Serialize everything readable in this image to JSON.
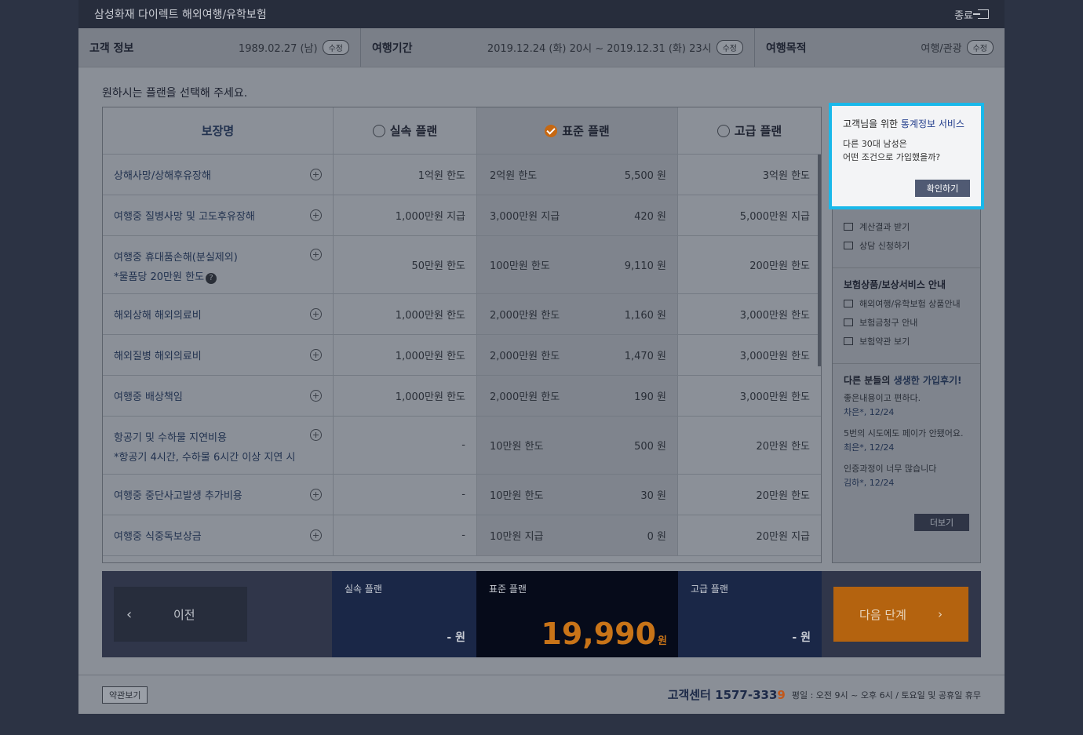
{
  "titlebar": {
    "title": "삼성화재 다이렉트 해외여행/유학보험",
    "exit_label": "종료"
  },
  "info": {
    "customer": {
      "label": "고객 정보",
      "value": "1989.02.27 (남)",
      "edit": "수정"
    },
    "period": {
      "label": "여행기간",
      "value": "2019.12.24 (화) 20시 ~ 2019.12.31 (화) 23시",
      "edit": "수정"
    },
    "purpose": {
      "label": "여행목적",
      "value": "여행/관광",
      "edit": "수정"
    }
  },
  "prompt": "원하시는 플랜을 선택해 주세요.",
  "table": {
    "headers": {
      "name": "보장명",
      "basic": "실속 플랜",
      "standard": "표준 플랜",
      "premium": "고급 플랜"
    },
    "rows": [
      {
        "name": "상해사망/상해후유장해",
        "basic": "1억원 한도",
        "std": "2억원 한도",
        "std_price": "5,500 원",
        "prem": "3억원 한도"
      },
      {
        "name": "여행중 질병사망 및 고도후유장해",
        "basic": "1,000만원 지급",
        "std": "3,000만원 지급",
        "std_price": "420 원",
        "prem": "5,000만원 지급"
      },
      {
        "name": "여행중 휴대품손해(분실제외)",
        "name2": "*물품당 20만원 한도",
        "basic": "50만원 한도",
        "std": "100만원 한도",
        "std_price": "9,110 원",
        "prem": "200만원 한도"
      },
      {
        "name": "해외상해 해외의료비",
        "basic": "1,000만원 한도",
        "std": "2,000만원 한도",
        "std_price": "1,160 원",
        "prem": "3,000만원 한도"
      },
      {
        "name": "해외질병 해외의료비",
        "basic": "1,000만원 한도",
        "std": "2,000만원 한도",
        "std_price": "1,470 원",
        "prem": "3,000만원 한도"
      },
      {
        "name": "여행중 배상책임",
        "basic": "1,000만원 한도",
        "std": "2,000만원 한도",
        "std_price": "190 원",
        "prem": "3,000만원 한도"
      },
      {
        "name": "항공기 및 수하물 지연비용",
        "name2": "*항공기 4시간, 수하물 6시간 이상 지연 시",
        "basic": "-",
        "std": "10만원 한도",
        "std_price": "500 원",
        "prem": "20만원 한도"
      },
      {
        "name": "여행중 중단사고발생 추가비용",
        "basic": "-",
        "std": "10만원 한도",
        "std_price": "30 원",
        "prem": "20만원 한도"
      },
      {
        "name": "여행중 식중독보상금",
        "basic": "-",
        "std": "10만원 지급",
        "std_price": "0 원",
        "prem": "20만원 지급"
      }
    ]
  },
  "popup": {
    "title_prefix": "고객님을 위한 ",
    "title_highlight": "통계정보 서비스",
    "line1": "다른 30대 남성은",
    "line2": "어떤 조건으로 가입했을까?",
    "button": "확인하기"
  },
  "sidebar": {
    "actions": [
      "계산결과 받기",
      "상담 신청하기"
    ],
    "guide_title": "보험상품/보상서비스 안내",
    "guides": [
      "해외여행/유학보험 상품안내",
      "보험금청구 안내",
      "보험약관 보기"
    ],
    "review_title_a": "다른 분들의 ",
    "review_title_b": "생생한 가입후기!",
    "reviews": [
      {
        "text": "좋은내용이고 편하다.",
        "who": "차은*, 12/24"
      },
      {
        "text": "5번의 시도에도 페이가 안됐어요.",
        "who": "최은*, 12/24"
      },
      {
        "text": "인증과정이 너무 많습니다",
        "who": "김하*, 12/24"
      }
    ],
    "more": "더보기"
  },
  "bottom": {
    "prev": "이전",
    "basic": {
      "label": "실속 플랜",
      "price": "- 원"
    },
    "standard": {
      "label": "표준 플랜",
      "price": "19,990",
      "unit": "원"
    },
    "premium": {
      "label": "고급 플랜",
      "price": "- 원"
    },
    "next": "다음 단계"
  },
  "footer": {
    "terms": "약관보기",
    "cc_label": "고객센터 1577-333",
    "cc_last": "9",
    "hours": "평일 : 오전 9시 ~ 오후 6시 / 토요일 및 공휴일 휴무"
  }
}
